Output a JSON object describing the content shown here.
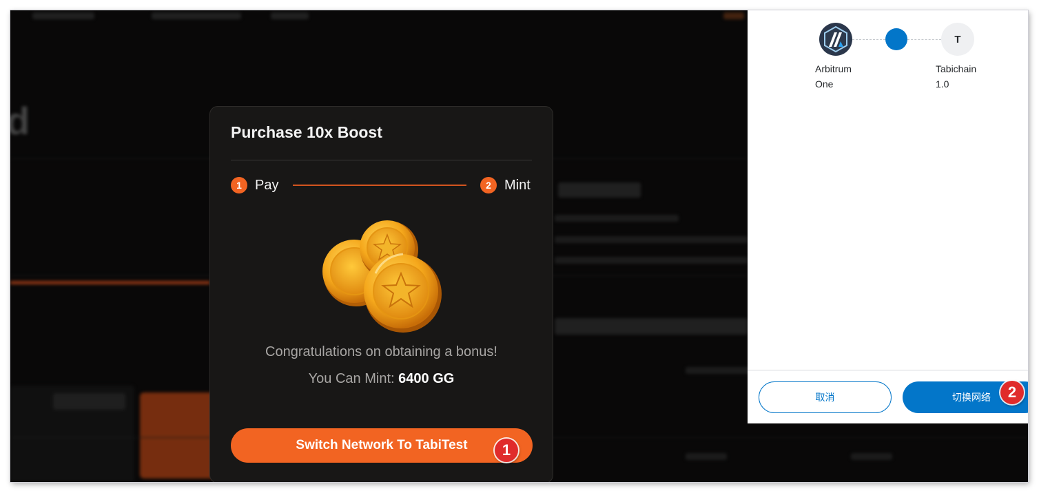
{
  "modal": {
    "title": "Purchase 10x Boost",
    "steps": [
      {
        "number": "1",
        "label": "Pay"
      },
      {
        "number": "2",
        "label": "Mint"
      }
    ],
    "congrats_text": "Congratulations on obtaining a bonus!",
    "mint_label": "You Can Mint:",
    "mint_value": "6400 GG",
    "switch_button_label": "Switch Network To TabiTest",
    "accent_color": "#f26422"
  },
  "wallet": {
    "from_network": {
      "line1": "Arbitrum",
      "line2": "One",
      "icon": "arbitrum-logo"
    },
    "to_network": {
      "icon_letter": "T",
      "line1": "Tabichain",
      "line2": "1.0"
    },
    "cancel_label": "取消",
    "switch_label": "切换网络",
    "accent_color": "#0376c9"
  },
  "annotations": [
    "1",
    "2"
  ],
  "background_page": {
    "blurred_heading": "d"
  }
}
